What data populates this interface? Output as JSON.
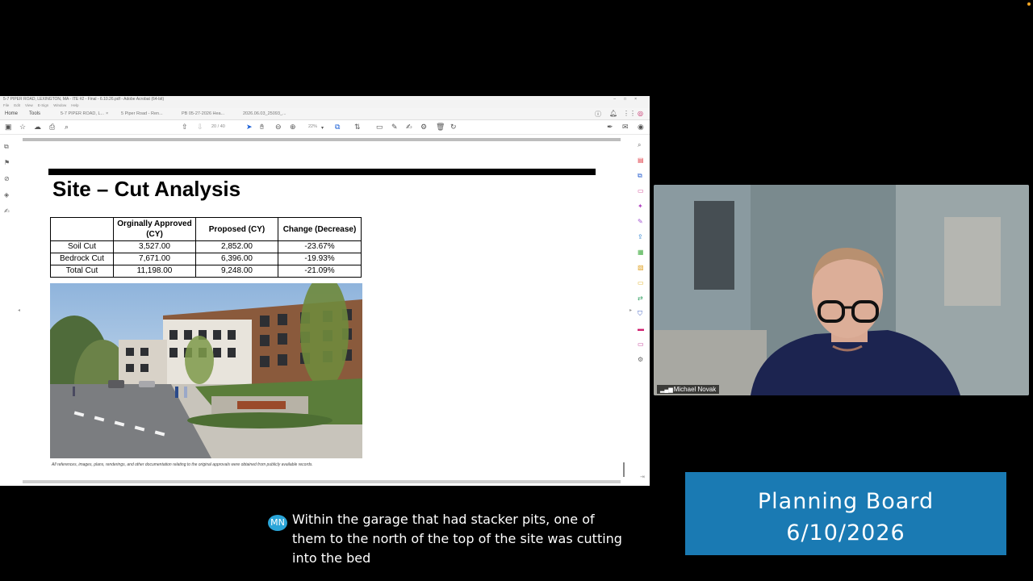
{
  "acrobat": {
    "title": "5-7 PIPER ROAD, LEXINGTON, MA - ITE #2 - Final - 6.10.26.pdf - Adobe Acrobat (64-bit)",
    "menu": [
      "File",
      "Edit",
      "View",
      "E-Sign",
      "Window",
      "Help"
    ],
    "home_tab": "Home",
    "tools_tab": "Tools",
    "doc_tabs": [
      "5-7 PIPER ROAD, L...",
      "5 Piper Road - Ren...",
      "PB 05-27-2026 Hea...",
      "2026.06.03_25093_..."
    ],
    "page_current": "20",
    "page_total": "/ 40",
    "zoom": "22%"
  },
  "slide": {
    "title": "Site – Cut Analysis",
    "table": {
      "headers": [
        "",
        "Orginally Approved (CY)",
        "Proposed (CY)",
        "Change (Decrease)"
      ],
      "rows": [
        [
          "Soil Cut",
          "3,527.00",
          "2,852.00",
          "-23.67%"
        ],
        [
          "Bedrock Cut",
          "7,671.00",
          "6,396.00",
          "-19.93%"
        ],
        [
          "Total Cut",
          "11,198.00",
          "9,248.00",
          "-21.09%"
        ]
      ]
    },
    "caption": "All references, images, plans, renderings, and other documentation relating to the original approvals were obtained from publicly available records."
  },
  "video": {
    "participant_name": "Michael Novak"
  },
  "board": {
    "line1": "Planning Board",
    "line2": "6/10/2026"
  },
  "transcript": {
    "initials": "MN",
    "text": "Within the garage that had stacker pits, one of them to the north of the top of the site was cutting into the bed"
  }
}
